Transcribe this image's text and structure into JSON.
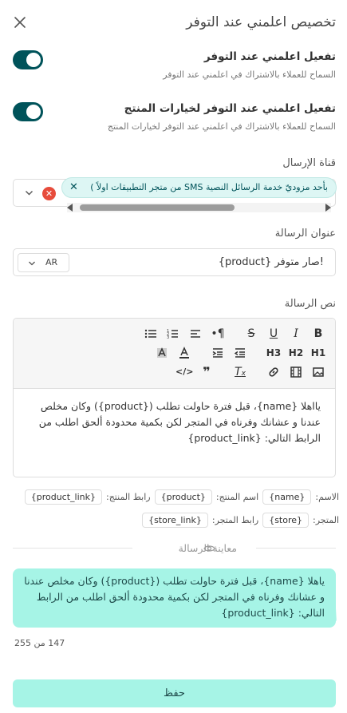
{
  "header": {
    "title": "تخصيص اعلمني عند التوفر"
  },
  "settings": [
    {
      "title": "تفعيل اعلمني عند التوفر",
      "description": "السماح للعملاء بالاشتراك في اعلمني عند التوفر",
      "enabled": true
    },
    {
      "title": "تفعيل اعلمني عند التوفر لخيارات المنتج",
      "description": "السماح للعملاء بالاشتراك في اعلمني عند التوفر لخيارات المنتج",
      "enabled": true
    }
  ],
  "channel": {
    "label": "قناة الإرسال",
    "selected_chip": "بأحد مزوديّ خدمة الرسائل النصية SMS من متجر التطبيقات اولاً )"
  },
  "subject": {
    "label": "عنوان الرسالة",
    "value": "{product} صار متوفر!",
    "language": "AR"
  },
  "body": {
    "label": "نص الرسالة",
    "text": "يااهلا {name}، قبل فترة حاولت تطلب ({product}) وكان مخلص عندنا و عشانك وفرناه في المتجر لكن بكمية محدودة ألحق اطلب من الرابط التالي: {product_link}"
  },
  "variables": {
    "row1": [
      {
        "label": "الاسم:",
        "tag": "{name}"
      },
      {
        "label": "اسم المنتج:",
        "tag": "{product}"
      },
      {
        "label": "رابط المنتج:",
        "tag": "{product_link}"
      }
    ],
    "row2": [
      {
        "label": "المتجر:",
        "tag": "{store}"
      },
      {
        "label": "رابط المتجر:",
        "tag": "{store_link}"
      }
    ]
  },
  "preview": {
    "label": "معاينة الرسالة",
    "text": "ياهلا {name}، قبل فترة حاولت تطلب ({product}) وكان مخلص عندنا و عشانك وفرناه في المتجر لكن بكمية محدودة ألحق اطلب من الرابط التالي: {product_link}"
  },
  "counter": "147 من 255",
  "save_label": "حفظ",
  "colors": {
    "toggle": "#00535a",
    "accent": "#a6f4e6",
    "chip_bg": "#ddf6f4",
    "danger": "#e74c3c"
  }
}
